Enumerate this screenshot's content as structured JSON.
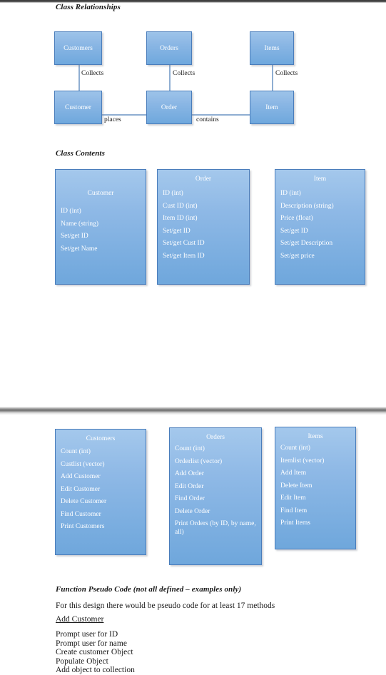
{
  "document": {
    "sections": {
      "class_relationships_heading": "Class Relationships",
      "class_contents_heading": "Class Contents",
      "pseudo_code_heading": "Function Pseudo Code (not all defined – examples only)"
    }
  },
  "relationships": {
    "collection_boxes": [
      {
        "label": "Customers"
      },
      {
        "label": "Orders"
      },
      {
        "label": "Items"
      }
    ],
    "entity_boxes": [
      {
        "label": "Customer"
      },
      {
        "label": "Order"
      },
      {
        "label": "Item"
      }
    ],
    "vertical_labels": [
      {
        "label": "Collects"
      },
      {
        "label": "Collects"
      },
      {
        "label": "Collects"
      }
    ],
    "horizontal_labels": [
      {
        "label": "places"
      },
      {
        "label": "contains"
      }
    ]
  },
  "class_contents": [
    {
      "title": "Customer",
      "members": [
        "ID (int)",
        "Name (string)",
        "Set/get ID",
        "Set/get Name"
      ]
    },
    {
      "title": "Order",
      "members": [
        "ID (int)",
        "Cust ID (int)",
        "Item ID (int)",
        "Set/get ID",
        "Set/get  Cust ID",
        "Set/get Item ID"
      ]
    },
    {
      "title": "Item",
      "members": [
        "ID (int)",
        "Description (string)",
        "Price (float)",
        "Set/get ID",
        "Set/get Description",
        "Set/get price"
      ]
    }
  ],
  "collection_classes": [
    {
      "title": "Customers",
      "members": [
        "Count (int)",
        "Custlist (vector)",
        "Add Customer",
        "Edit Customer",
        "Delete Customer",
        "Find Customer",
        "Print Customers"
      ]
    },
    {
      "title": "Orders",
      "members": [
        "Count (int)",
        "Orderlist (vector)",
        "Add Order",
        "Edit Order",
        "Find Order",
        "Delete Order",
        "Print Orders (by ID, by name, all)"
      ]
    },
    {
      "title": "Items",
      "members": [
        "Count (int)",
        "Itemlist (vector)",
        "Add Item",
        "Delete Item",
        "Edit Item",
        "Find Item",
        "Print Items"
      ]
    }
  ],
  "pseudo_code": {
    "intro": "For this design there would be pseudo code for at least 17 methods",
    "function_name": "Add Customer",
    "steps": [
      "Prompt user for ID",
      "Prompt user for name",
      "Create customer Object",
      "Populate Object",
      "Add object to collection"
    ]
  },
  "colors": {
    "box_fill_top": "#9dc3e9",
    "box_fill_bottom": "#6fa8dd",
    "box_border": "#4a7dbb",
    "connector": "#8faed2",
    "text_dark": "#1a1a1a",
    "box_text": "#ffffff"
  }
}
